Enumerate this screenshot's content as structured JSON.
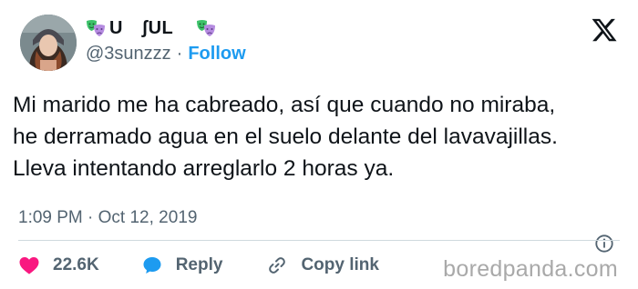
{
  "author": {
    "display_name": "U ʃUL ",
    "handle": "@3sunzzz",
    "separator": "·",
    "follow_label": "Follow",
    "emoji_icon": "performing-arts-masks-icon"
  },
  "tweet": {
    "lines": [
      "Mi marido me ha cabreado, así que cuando no miraba,",
      "he derramado agua en el suelo delante del lavavajillas.",
      "Lleva intentando arreglarlo 2 horas ya."
    ]
  },
  "meta": {
    "time": "1:09 PM",
    "separator": "·",
    "date": "Oct 12, 2019"
  },
  "actions": {
    "like_count": "22.6K",
    "reply_label": "Reply",
    "copy_link_label": "Copy link"
  },
  "watermark": "boredpanda.com",
  "colors": {
    "accent": "#1d9bf0",
    "like": "#f91880",
    "secondary_text": "#536471",
    "divider": "#cfd9de",
    "mask_green": "#3cc36a",
    "mask_purple": "#b58be0"
  }
}
